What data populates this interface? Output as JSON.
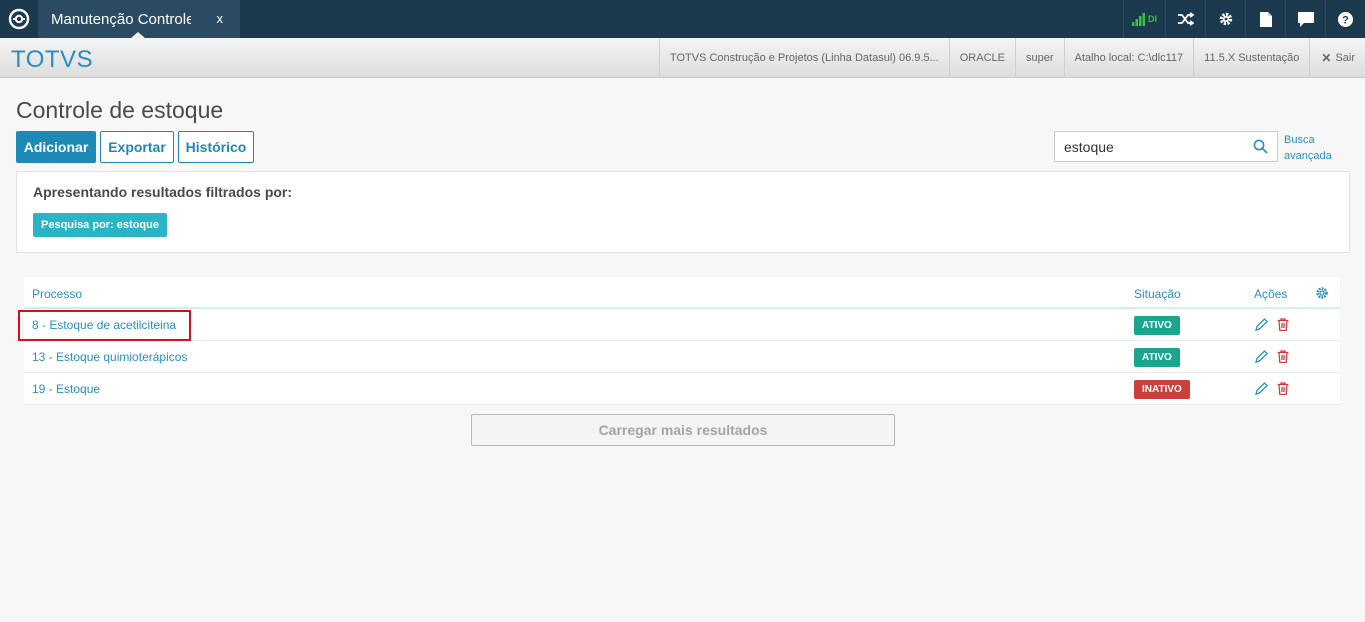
{
  "topbar": {
    "tab_title": "Manutenção Controle de estoque",
    "tab_close": "x",
    "signal_label": "DI"
  },
  "header": {
    "brand": "TOTVS",
    "info": [
      "TOTVS Construção e Projetos (Linha Datasul) 06.9.5...",
      "ORACLE",
      "super",
      "Atalho local: C:\\dlc117",
      "11.5.X Sustentação"
    ],
    "exit_label": "Sair"
  },
  "page": {
    "title": "Controle de estoque",
    "buttons": {
      "add": "Adicionar",
      "export": "Exportar",
      "history": "Histórico"
    },
    "search_value": "estoque",
    "advanced_search": [
      "Busca",
      "avançada"
    ]
  },
  "filter": {
    "heading": "Apresentando resultados filtrados por:",
    "tag": "Pesquisa por: estoque"
  },
  "table": {
    "columns": {
      "process": "Processo",
      "status": "Situação",
      "actions": "Ações"
    },
    "rows": [
      {
        "process": "8 - Estoque de acetilciteina",
        "status": "ATIVO"
      },
      {
        "process": "13 - Estoque quimioterápicos",
        "status": "ATIVO"
      },
      {
        "process": "19 - Estoque",
        "status": "INATIVO"
      }
    ]
  },
  "load_more": "Carregar mais resultados",
  "colors": {
    "topbar": "#1c3a4e",
    "accent": "#1d8ab5",
    "active": "#1aa68c",
    "inactive": "#c9403c",
    "signal": "#39c03c",
    "delete": "#c9403c"
  }
}
